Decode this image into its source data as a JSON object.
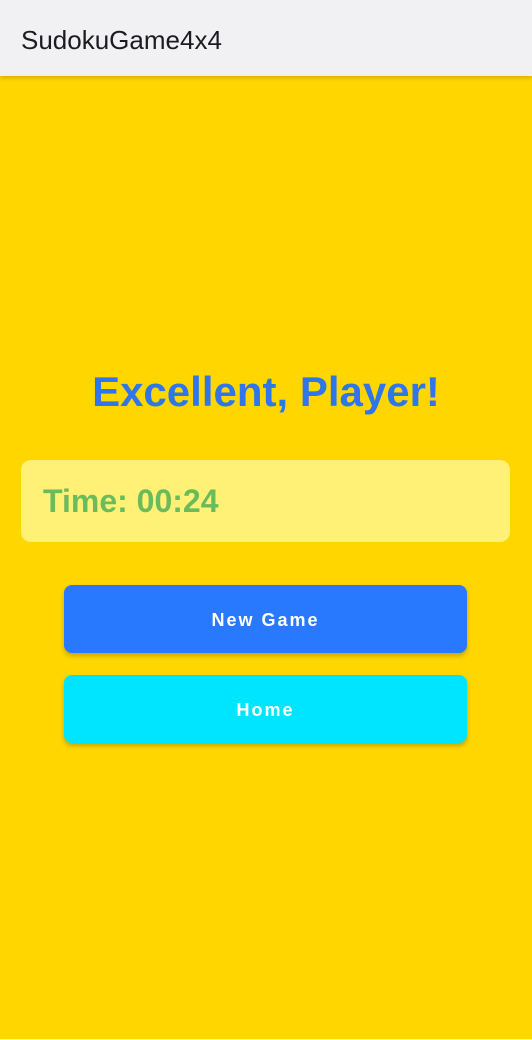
{
  "app_bar": {
    "title": "SudokuGame4x4"
  },
  "result": {
    "headline": "Excellent, Player!",
    "time_text": "Time: 00:24"
  },
  "buttons": {
    "new_game_label": "New Game",
    "home_label": "Home"
  },
  "colors": {
    "background": "#ffd600",
    "app_bar": "#f1f0f3",
    "headline": "#2f76ec",
    "time_card": "#fff176",
    "time_text": "#6abb5b",
    "new_game_button": "#2979ff",
    "home_button": "#00e5ff"
  }
}
